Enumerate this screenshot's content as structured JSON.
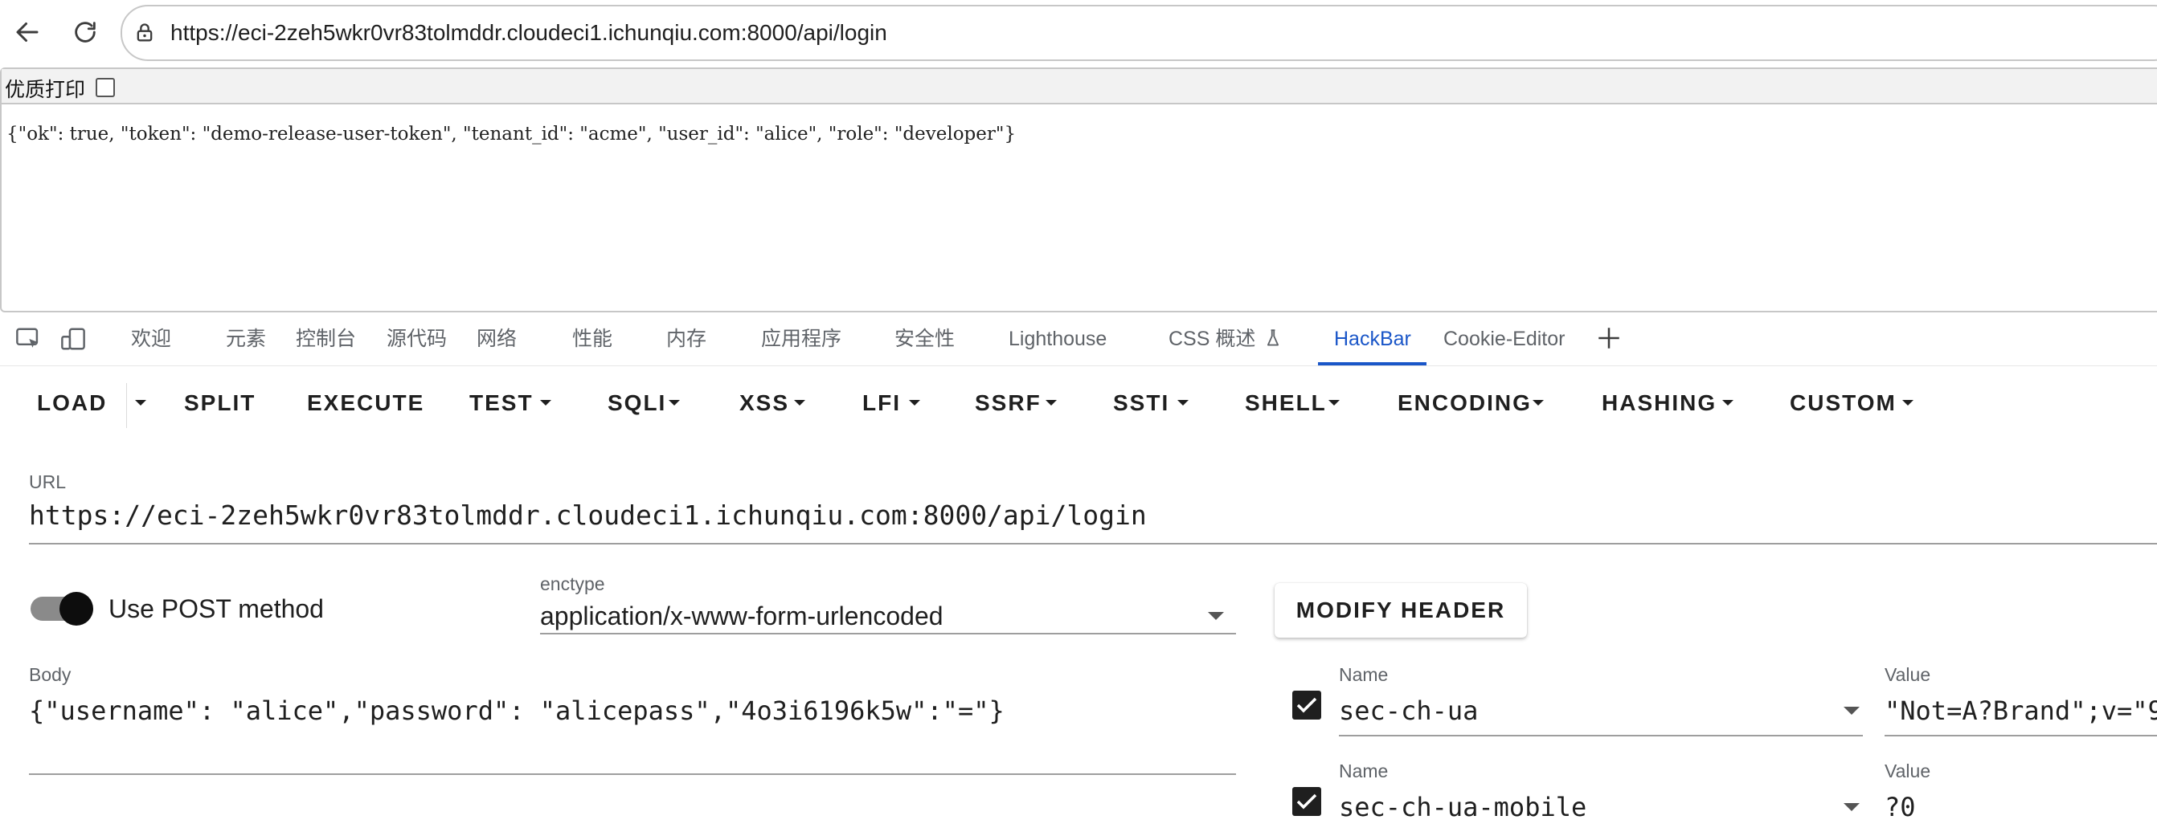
{
  "browser": {
    "url": "https://eci-2zeh5wkr0vr83tolmddr.cloudeci1.ichunqiu.com:8000/api/login"
  },
  "page": {
    "print_label": "优质打印",
    "response": "{\"ok\": true, \"token\": \"demo-release-user-token\", \"tenant_id\": \"acme\", \"user_id\": \"alice\", \"role\": \"developer\"}"
  },
  "devtools": {
    "tabs": [
      {
        "label": "欢迎"
      },
      {
        "label": "元素"
      },
      {
        "label": "控制台"
      },
      {
        "label": "源代码"
      },
      {
        "label": "网络"
      },
      {
        "label": "性能"
      },
      {
        "label": "内存"
      },
      {
        "label": "应用程序"
      },
      {
        "label": "安全性"
      },
      {
        "label": "Lighthouse"
      },
      {
        "label": "CSS 概述"
      },
      {
        "label": "HackBar"
      },
      {
        "label": "Cookie-Editor"
      }
    ],
    "active_tab": "HackBar"
  },
  "hackbar": {
    "toolbar": {
      "load": "LOAD",
      "split": "SPLIT",
      "execute": "EXECUTE",
      "test": "TEST",
      "sqli": "SQLI",
      "xss": "XSS",
      "lfi": "LFI",
      "ssrf": "SSRF",
      "ssti": "SSTI",
      "shell": "SHELL",
      "encoding": "ENCODING",
      "hashing": "HASHING",
      "custom": "CUSTOM"
    },
    "url_label": "URL",
    "url_value": "https://eci-2zeh5wkr0vr83tolmddr.cloudeci1.ichunqiu.com:8000/api/login",
    "post_method_label": "Use POST method",
    "post_enabled": true,
    "enctype_label": "enctype",
    "enctype_value": "application/x-www-form-urlencoded",
    "modify_header_label": "MODIFY HEADER",
    "body_label": "Body",
    "body_value": "{\"username\": \"alice\",\"password\": \"alicepass\",\"4o3i6196k5w\":\"=\"}",
    "headers": [
      {
        "name_label": "Name",
        "name": "sec-ch-ua",
        "value_label": "Value",
        "value": "\"Not=A?Brand\";v=\"9",
        "enabled": true
      },
      {
        "name_label": "Name",
        "name": "sec-ch-ua-mobile",
        "value_label": "Value",
        "value": "?0",
        "enabled": true
      }
    ]
  },
  "colors": {
    "accent": "#1a56c8",
    "text": "#1f1f1f",
    "muted": "#5f6368",
    "border": "#c7c7c7"
  },
  "icons": [
    "back-arrow-icon",
    "reload-icon",
    "lock-icon",
    "inspect-element-icon",
    "device-toolbar-icon",
    "experiment-flask-icon",
    "plus-icon",
    "checkmark-icon"
  ]
}
